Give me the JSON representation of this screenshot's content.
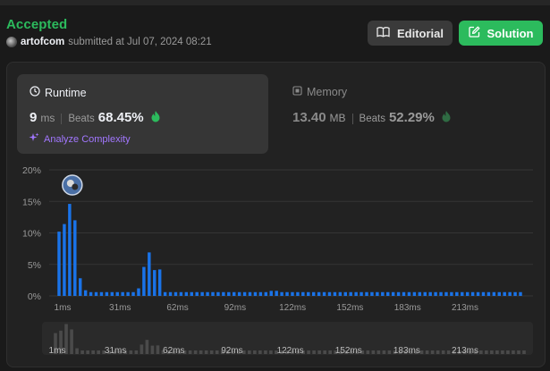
{
  "header": {
    "status": "Accepted",
    "username": "artofcom",
    "submitted_text": "submitted at Jul 07, 2024 08:21",
    "editorial_label": "Editorial",
    "solution_label": "Solution"
  },
  "runtime": {
    "label": "Runtime",
    "value": "9",
    "unit": "ms",
    "beats_label": "Beats",
    "beats_pct": "68.45%",
    "analyze_label": "Analyze Complexity"
  },
  "memory": {
    "label": "Memory",
    "value": "13.40",
    "unit": "MB",
    "beats_label": "Beats",
    "beats_pct": "52.29%"
  },
  "colors": {
    "accepted": "#2cbb5d",
    "bar": "#1a73e8",
    "analyze": "#a277ff",
    "solution_bg": "#2cbb5d"
  },
  "chart_data": {
    "type": "bar",
    "title": "",
    "xlabel": "",
    "ylabel": "",
    "ylim": [
      0,
      20
    ],
    "y_ticks": [
      "20%",
      "15%",
      "10%",
      "5%",
      "0%"
    ],
    "x_ticks": [
      "1ms",
      "31ms",
      "62ms",
      "92ms",
      "122ms",
      "152ms",
      "183ms",
      "213ms"
    ],
    "current_bin": 3,
    "values": [
      10.2,
      11.4,
      14.6,
      12.0,
      2.8,
      0.9,
      0.6,
      0.6,
      0.6,
      0.6,
      0.6,
      0.6,
      0.6,
      0.6,
      0.6,
      1.2,
      4.6,
      6.9,
      4.1,
      4.2,
      0.6,
      0.6,
      0.6,
      0.6,
      0.6,
      0.6,
      0.6,
      0.6,
      0.6,
      0.6,
      0.6,
      0.6,
      0.6,
      0.6,
      0.6,
      0.6,
      0.6,
      0.6,
      0.6,
      0.6,
      0.8,
      0.8,
      0.6,
      0.6,
      0.6,
      0.6,
      0.6,
      0.6,
      0.6,
      0.6,
      0.6,
      0.6,
      0.6,
      0.6,
      0.6,
      0.6,
      0.6,
      0.6,
      0.6,
      0.6,
      0.6,
      0.6,
      0.6,
      0.6,
      0.6,
      0.6,
      0.6,
      0.6,
      0.6,
      0.6,
      0.6,
      0.6,
      0.6,
      0.6,
      0.6,
      0.6,
      0.6,
      0.6,
      0.6,
      0.6,
      0.6,
      0.6,
      0.6,
      0.6,
      0.6,
      0.6,
      0.6,
      0.6
    ],
    "overview_x_ticks": [
      "1ms",
      "31ms",
      "62ms",
      "92ms",
      "122ms",
      "152ms",
      "183ms",
      "213ms"
    ]
  }
}
